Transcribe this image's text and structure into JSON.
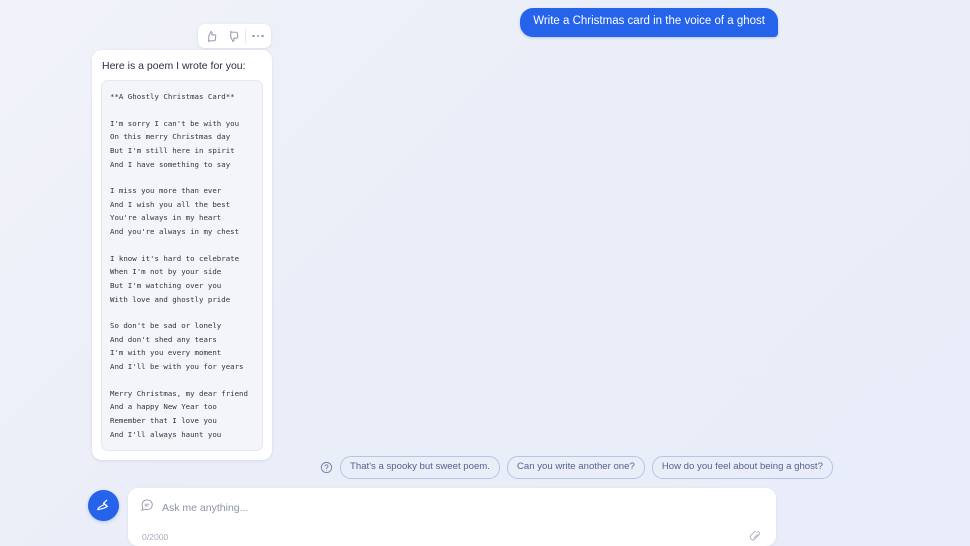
{
  "user_message": {
    "text": "Write a Christmas card in the voice of a ghost"
  },
  "assistant_message": {
    "intro": "Here is a poem I wrote for you:",
    "poem_lines": [
      "**A Ghostly Christmas Card**",
      "",
      "I'm sorry I can't be with you",
      "On this merry Christmas day",
      "But I'm still here in spirit",
      "And I have something to say",
      "",
      "I miss you more than ever",
      "And I wish you all the best",
      "You're always in my heart",
      "And you're always in my chest",
      "",
      "I know it's hard to celebrate",
      "When I'm not by your side",
      "But I'm watching over you",
      "With love and ghostly pride",
      "",
      "So don't be sad or lonely",
      "And don't shed any tears",
      "I'm with you every moment",
      "And I'll be with you for years",
      "",
      "Merry Christmas, my dear friend",
      "And a happy New Year too",
      "Remember that I love you",
      "And I'll always haunt you"
    ],
    "actions": [
      {
        "name": "thumbs-up-icon",
        "label": "Like"
      },
      {
        "name": "thumbs-down-icon",
        "label": "Dislike"
      },
      {
        "name": "more-options-icon",
        "label": "More options"
      }
    ]
  },
  "suggestions": {
    "help_icon": "question-circle-icon",
    "chips": [
      "That's a spooky but sweet poem.",
      "Can you write another one?",
      "How do you feel about being a ghost?"
    ]
  },
  "composer": {
    "placeholder": "Ask me anything...",
    "counter": "0/2000",
    "chat_icon": "chat-bubble-icon",
    "attach_icon": "pin-icon",
    "avatar_icon": "broom-icon"
  },
  "colors": {
    "user_bubble": "#2563eb",
    "accent": "#2563eb",
    "page_bg": "#eaeef8",
    "card_bg": "#ffffff",
    "code_bg": "#f4f5f9",
    "chip_border": "#b9c3e4"
  }
}
